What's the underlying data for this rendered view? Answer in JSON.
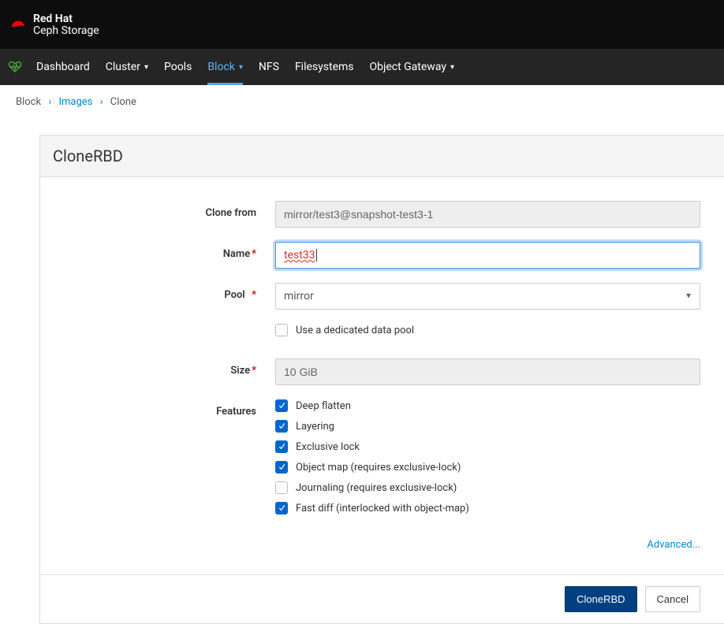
{
  "brand": {
    "top": "Red Hat",
    "bottom": "Ceph Storage"
  },
  "nav": {
    "dashboard": "Dashboard",
    "cluster": "Cluster",
    "pools": "Pools",
    "block": "Block",
    "nfs": "NFS",
    "filesystems": "Filesystems",
    "object_gateway": "Object Gateway"
  },
  "breadcrumb": {
    "block": "Block",
    "images": "Images",
    "clone": "Clone"
  },
  "panel": {
    "title": "CloneRBD"
  },
  "form": {
    "clone_from_label": "Clone from",
    "clone_from_value": "mirror/test3@snapshot-test3-1",
    "name_label": "Name",
    "name_value": "test33",
    "pool_label": "Pool",
    "pool_value": "mirror",
    "dedicated_pool_label": "Use a dedicated data pool",
    "size_label": "Size",
    "size_value": "10 GiB",
    "features_label": "Features",
    "features": [
      {
        "label": "Deep flatten",
        "checked": true
      },
      {
        "label": "Layering",
        "checked": true
      },
      {
        "label": "Exclusive lock",
        "checked": true
      },
      {
        "label": "Object map (requires exclusive-lock)",
        "checked": true
      },
      {
        "label": "Journaling (requires exclusive-lock)",
        "checked": false
      },
      {
        "label": "Fast diff (interlocked with object-map)",
        "checked": true
      }
    ],
    "advanced": "Advanced..."
  },
  "actions": {
    "submit": "CloneRBD",
    "cancel": "Cancel"
  }
}
